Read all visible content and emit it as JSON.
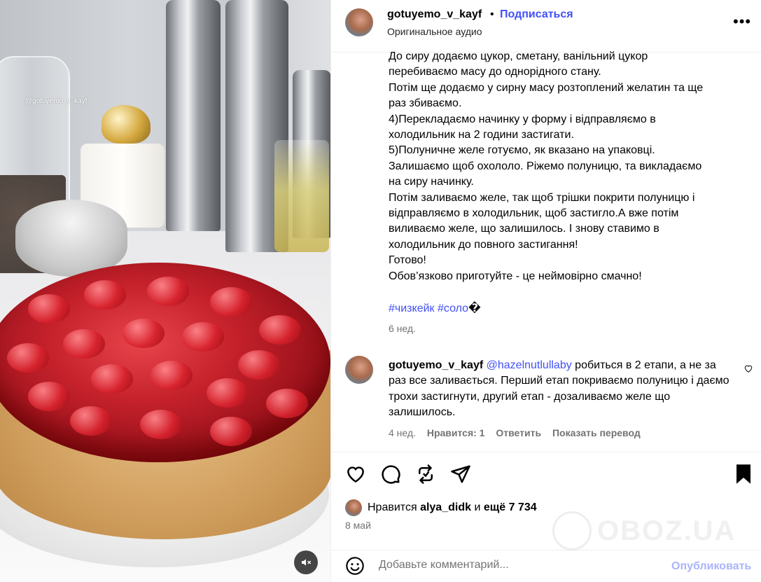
{
  "media": {
    "watermark": "@gotuyemo_v_kayf",
    "mute_icon": "speaker-muted-icon"
  },
  "header": {
    "username": "gotuyemo_v_kayf",
    "separator": "•",
    "follow_label": "Подписаться",
    "audio_label": "Оригинальное аудио",
    "more_label": "•••"
  },
  "caption": {
    "lines": [
      "До сиру додаємо цукор, сметану, ванільний цукор",
      "перебиваємо масу до однорідного стану.",
      "Потім ще додаємо у сирну масу розтоплений желатин та ще",
      "раз збиваємо.",
      "4)Перекладаємо начинку у форму і відправляємо в",
      "холодильник на 2 години застигати.",
      "5)Полуничне желе готуємо, як вказано на упаковці.",
      "Залишаємо щоб охололо. Ріжемо полуницю, та викладаємо",
      "на сиру начинку.",
      "Потім заливаємо желе, так щоб трішки покрити полуницю і",
      "відправляємо в холодильник, щоб застигло.А вже потім",
      "виливаємо желе, що залишилось. І знову ставимо в",
      "холодильник до повного застигання!",
      "Готово!",
      "Обов’язково приготуйте - це неймовірно смачно!"
    ],
    "hashtag1": "#чизкейк",
    "hashtag2": "#соло",
    "hashtag_tail": "�",
    "time": "6 нед."
  },
  "comment": {
    "username": "gotuyemo_v_kayf",
    "mention": "@hazelnutlullaby",
    "text": " робиться в 2 етапи, а не за раз все заливається. Перший етап покриваємо полуницю і даємо трохи застигнути, другий етап - дозаливаємо желе що залишилось.",
    "time": "4 нед.",
    "likes": "Нравится: 1",
    "reply": "Ответить",
    "translate": "Показать перевод"
  },
  "actions": {
    "liked_by_prefix": "Нравится",
    "liked_by_user": "alya_didk",
    "liked_by_and": "и",
    "liked_by_count": "ещё 7 734",
    "date": "8 май"
  },
  "comment_box": {
    "placeholder": "Добавьте комментарий...",
    "publish_label": "Опубликовать"
  },
  "overlay": {
    "watermark_text": "OBOZ.UA"
  },
  "colors": {
    "link_blue": "#4150f7",
    "publish_disabled": "#aab4fc",
    "muted_text": "#737373"
  }
}
